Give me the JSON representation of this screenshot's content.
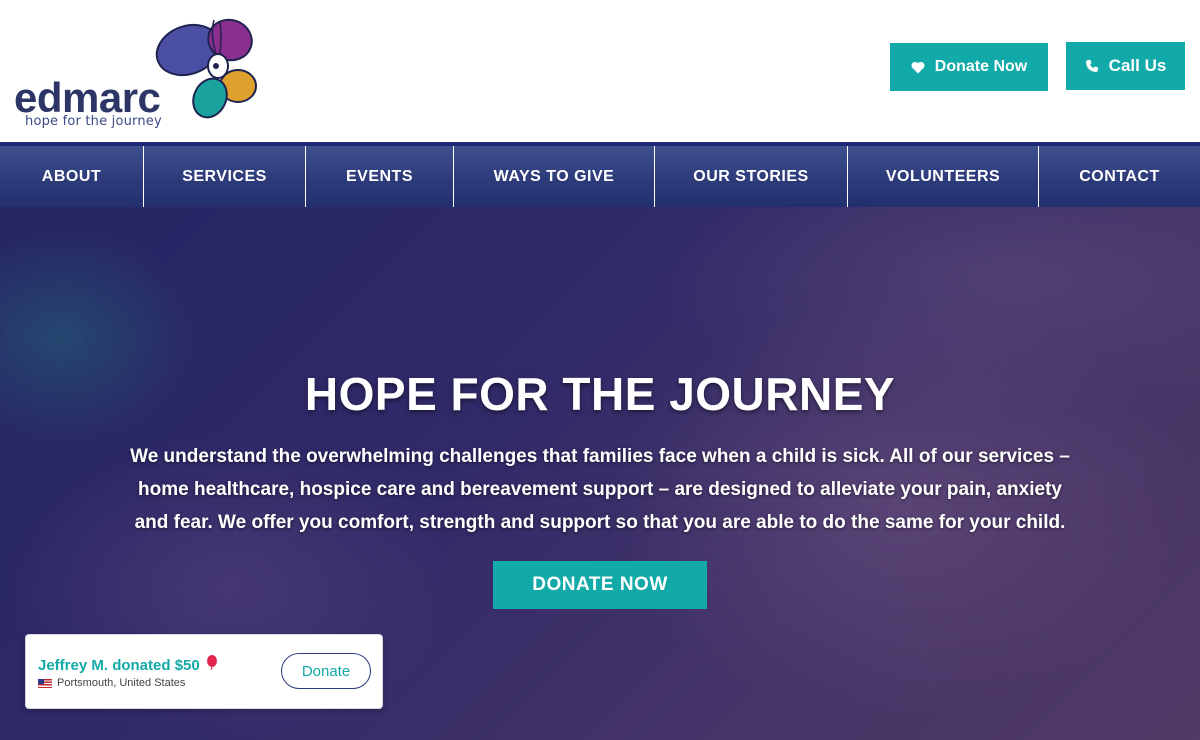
{
  "header": {
    "logo": {
      "word": "edmarc",
      "tagline": "hope for the journey"
    },
    "donate_button": "Donate Now",
    "call_button": "Call Us"
  },
  "nav": {
    "items": [
      {
        "label": "ABOUT"
      },
      {
        "label": "SERVICES"
      },
      {
        "label": "EVENTS"
      },
      {
        "label": "WAYS TO GIVE"
      },
      {
        "label": "OUR STORIES"
      },
      {
        "label": "VOLUNTEERS"
      },
      {
        "label": "CONTACT"
      }
    ]
  },
  "hero": {
    "title": "HOPE FOR THE JOURNEY",
    "text": "We understand the overwhelming challenges that families face when a child is sick. All of our services – home healthcare, hospice care and bereavement support – are designed to alleviate your pain, anxiety and fear. We offer you comfort, strength and support so that you are able to do the same for your child.",
    "button": "DONATE NOW"
  },
  "toast": {
    "message": "Jeffrey M. donated $50",
    "location": "Portsmouth, United States",
    "button": "Donate"
  },
  "colors": {
    "brand_navy": "#2c3566",
    "accent_teal": "#12aaa8",
    "nav_blue": "#2d3b7a"
  },
  "icons": [
    "butterfly-logo-icon",
    "heart-icon",
    "phone-icon",
    "balloon-icon",
    "us-flag-icon"
  ]
}
